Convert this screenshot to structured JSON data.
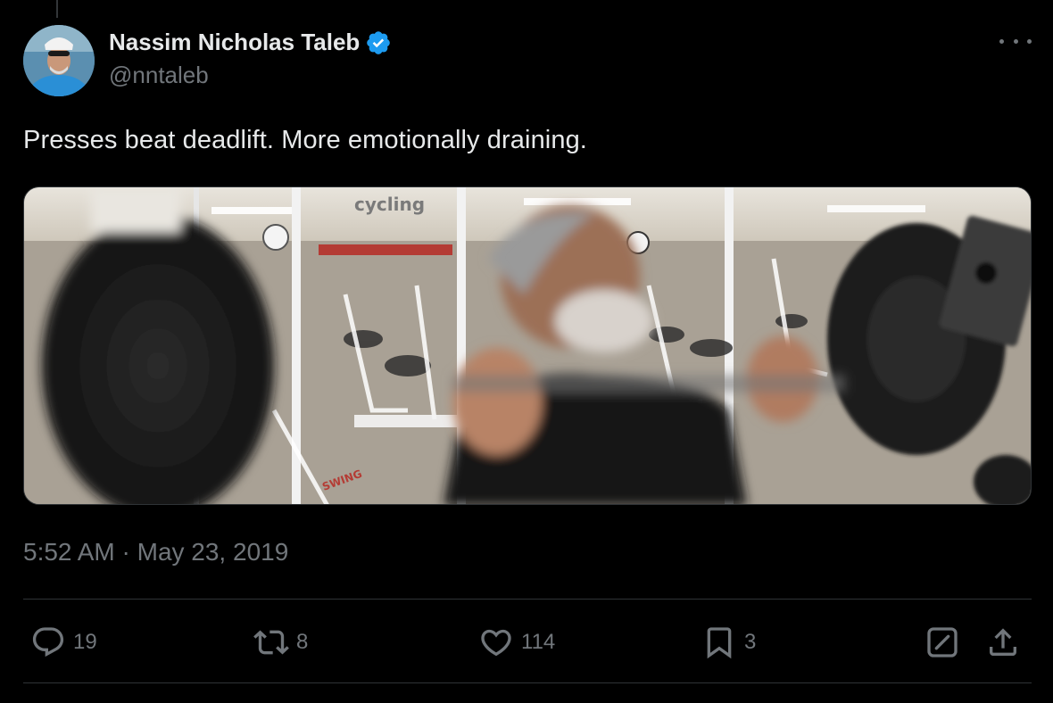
{
  "tweet": {
    "author": {
      "display_name": "Nassim Nicholas Taleb",
      "handle": "@nntaleb",
      "verified": true,
      "avatar_icon": "avatar-photo"
    },
    "text": "Presses beat deadlift. More emotionally draining.",
    "media": {
      "type": "photo",
      "background_sign": "cycling",
      "machine_label": "SWING"
    },
    "timestamp": "5:52 AM · May 23, 2019",
    "stats": {
      "replies": "19",
      "reposts": "8",
      "likes": "114",
      "bookmarks": "3"
    }
  },
  "icons": {
    "more": "more-icon",
    "reply": "reply-icon",
    "repost": "repost-icon",
    "like": "like-icon",
    "bookmark": "bookmark-icon",
    "grok": "grok-icon",
    "share": "share-icon"
  },
  "colors": {
    "background": "#000000",
    "text": "#e7e9ea",
    "muted": "#71767b",
    "verified": "#1d9bf0",
    "divider": "#2f3336"
  }
}
